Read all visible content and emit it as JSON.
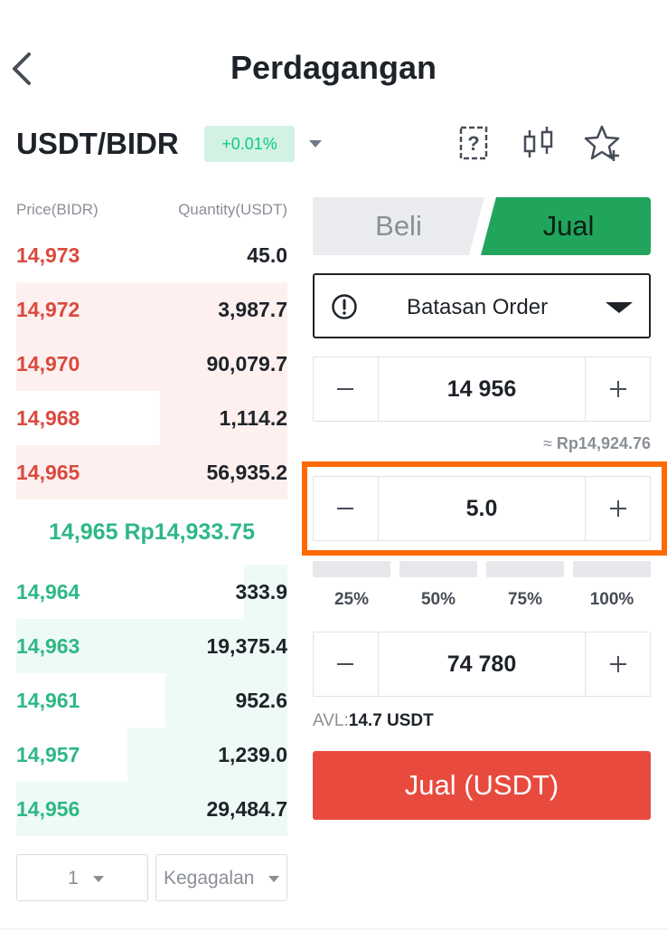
{
  "header": {
    "title": "Perdagangan",
    "back_icon": "chevron-left-icon"
  },
  "pair": {
    "name": "USDT/BIDR",
    "change": "+0.01%",
    "icons": [
      "help-doc-icon",
      "candlestick-chart-icon",
      "add-favorite-icon"
    ]
  },
  "orderbook": {
    "price_header": "Price(BIDR)",
    "quantity_header": "Quantity(USDT)",
    "asks": [
      {
        "price": "14,973",
        "qty": "45.0",
        "depth": 0.0
      },
      {
        "price": "14,972",
        "qty": "3,987.7",
        "depth": 1.0
      },
      {
        "price": "14,970",
        "qty": "90,079.7",
        "depth": 1.0
      },
      {
        "price": "14,968",
        "qty": "1,114.2",
        "depth": 0.47
      },
      {
        "price": "14,965",
        "qty": "56,935.2",
        "depth": 1.0
      }
    ],
    "last_price": "14,965",
    "last_price_fiat": "Rp14,933.75",
    "bids": [
      {
        "price": "14,964",
        "qty": "333.9",
        "depth": 0.16
      },
      {
        "price": "14,963",
        "qty": "19,375.4",
        "depth": 1.0
      },
      {
        "price": "14,961",
        "qty": "952.6",
        "depth": 0.45
      },
      {
        "price": "14,957",
        "qty": "1,239.0",
        "depth": 0.59
      },
      {
        "price": "14,956",
        "qty": "29,484.7",
        "depth": 1.0
      }
    ],
    "depth_selector": "1",
    "display_selector": "Kegagalan"
  },
  "colors": {
    "ask": "#d94a3e",
    "bid": "#2eb886",
    "sell_tab": "#21a45c",
    "sell_button": "#e84a3e",
    "highlight": "#ff6a00"
  },
  "form": {
    "tab_buy": "Beli",
    "tab_sell": "Jual",
    "active_tab": "Jual",
    "order_type": "Batasan Order",
    "price_value": "14 956",
    "approx_prefix": "≈",
    "approx_value": "Rp14,924.76",
    "amount_value": "5.0",
    "percentages": [
      "25%",
      "50%",
      "75%",
      "100%"
    ],
    "total_value": "74 780",
    "avl_label": "AVL:",
    "avl_value": "14.7 USDT",
    "submit_label": "Jual (USDT)"
  }
}
